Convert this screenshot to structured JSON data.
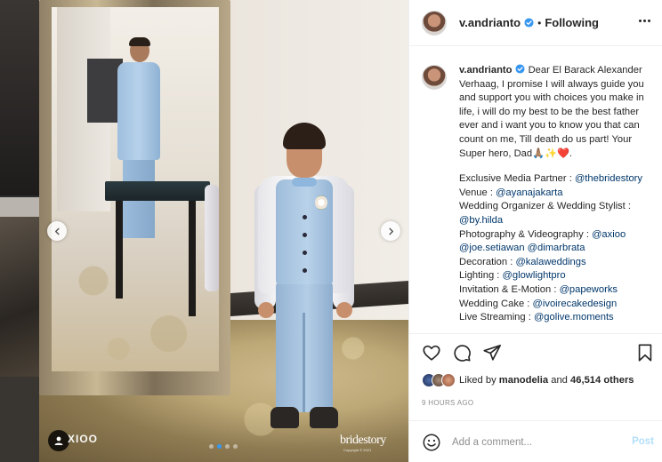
{
  "post": {
    "author": "v.andrianto",
    "follow_state": "Following",
    "bullet": "•",
    "caption": {
      "body": "Dear El Barack Alexander Verhaag, I promise I will always guide you and support you with choices you make in life, i will do my best to be the best father ever and i want you to know you that can count on me, Till death do us part! Your Super hero, Dad🙏🏽✨❤️.",
      "credits": [
        {
          "label": "Exclusive Media Partner : ",
          "mentions": [
            "@thebridestory"
          ]
        },
        {
          "label": "Venue : ",
          "mentions": [
            "@ayanajakarta"
          ]
        },
        {
          "label": "Wedding Organizer & Wedding Stylist : ",
          "mentions": [
            "@by.hilda"
          ]
        },
        {
          "label": "Photography & Videography : ",
          "mentions": [
            "@axioo",
            "@joe.setiawan",
            "@dimarbrata"
          ]
        },
        {
          "label": "Decoration : ",
          "mentions": [
            "@kalaweddings"
          ]
        },
        {
          "label": "Lighting : ",
          "mentions": [
            "@glowlightpro"
          ]
        },
        {
          "label": "Invitation & E-Motion : ",
          "mentions": [
            "@papeworks"
          ]
        },
        {
          "label": "Wedding Cake : ",
          "mentions": [
            "@ivoirecakedesign"
          ]
        },
        {
          "label": "Live Streaming : ",
          "mentions": [
            "@golive.moments"
          ]
        }
      ]
    },
    "likes": {
      "prefix": "Liked by",
      "user": "manodelia",
      "connector": "and",
      "count": "46,514 others"
    },
    "timestamp": "9 HOURS AGO",
    "comment": {
      "placeholder": "Add a comment...",
      "post_label": "Post"
    }
  },
  "media": {
    "watermark_left": "XIOO",
    "watermark_right": "bridestory",
    "watermark_sub": "Copyright © 2021",
    "carousel": {
      "total": 4,
      "active_index": 1
    }
  },
  "colors": {
    "verified": "#3897f0",
    "mention": "#00376b",
    "heart": "#ed4956",
    "post_disabled": "#b2dffc"
  },
  "icons": [
    "verified-badge-icon",
    "more-options-icon",
    "heart-icon",
    "comment-icon",
    "share-icon",
    "bookmark-icon",
    "emoji-icon",
    "chevron-left-icon",
    "chevron-right-icon",
    "user-tag-icon"
  ]
}
